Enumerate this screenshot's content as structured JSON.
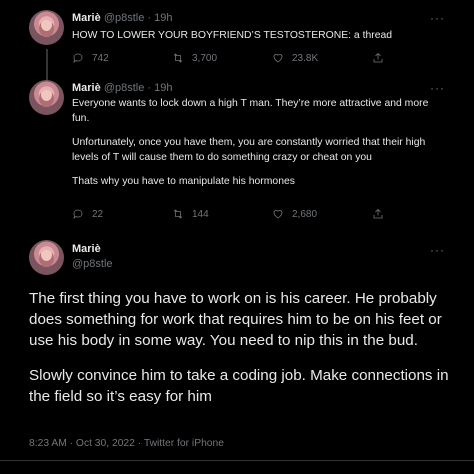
{
  "tweet1": {
    "name": "Mariè",
    "handle": "@p8stle",
    "dot": "·",
    "time": "19h",
    "more": "···",
    "text": "HOW TO LOWER YOUR BOYFRIEND’S TESTOSTERONE: a thread",
    "replies": "742",
    "retweets": "3,700",
    "likes": "23.8K"
  },
  "tweet2": {
    "name": "Mariè",
    "handle": "@p8stle",
    "dot": "·",
    "time": "19h",
    "more": "···",
    "paragraphs": [
      "Everyone wants to lock down a high T man. They’re more attractive and more fun.",
      "Unfortunately, once you have them, you are constantly worried that their high levels of T will cause them to do something crazy or cheat on you",
      "Thats why you have to manipulate his hormones"
    ],
    "replies": "22",
    "retweets": "144",
    "likes": "2,680"
  },
  "main_tweet": {
    "name": "Mariè",
    "handle": "@p8stle",
    "more": "···",
    "paragraphs": [
      "The first thing you have to work on is his career. He probably does something for work that requires him to be on his feet or use his body in some way. You need to nip this in the bud.",
      "Slowly convince him to take a coding job. Make connections in the field so it’s easy for him"
    ],
    "meta": "8:23 AM · Oct 30, 2022 · Twitter for iPhone"
  },
  "icons": [
    "reply-icon",
    "retweet-icon",
    "like-icon",
    "share-icon",
    "more-icon"
  ],
  "colors": {
    "background": "#000000",
    "text": "#e7e9ea",
    "muted": "#71767b",
    "divider": "#2f3336"
  }
}
